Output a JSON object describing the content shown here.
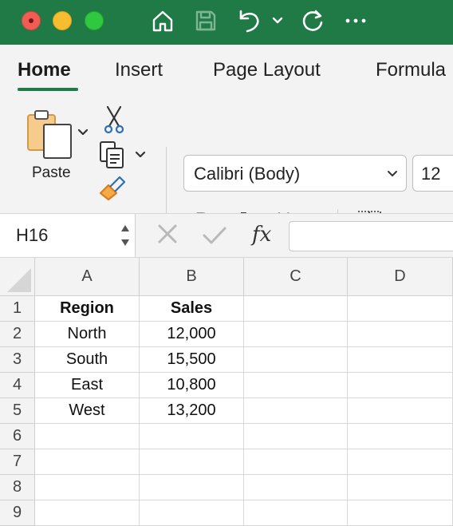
{
  "ribbon": {
    "tabs": [
      {
        "label": "Home",
        "active": true
      },
      {
        "label": "Insert"
      },
      {
        "label": "Page Layout"
      },
      {
        "label": "Formula"
      }
    ],
    "paste_label": "Paste",
    "font_name": "Calibri (Body)",
    "font_size": "12",
    "bold_label": "B",
    "italic_label": "I",
    "underline_label": "U"
  },
  "formula_bar": {
    "name_box": "H16",
    "fx_label": "fx",
    "formula": ""
  },
  "sheet": {
    "columns": [
      "A",
      "B",
      "C",
      "D"
    ],
    "rows": [
      "1",
      "2",
      "3",
      "4",
      "5",
      "6",
      "7",
      "8",
      "9"
    ],
    "cells": [
      [
        "Region",
        "Sales"
      ],
      [
        "North",
        "12,000"
      ],
      [
        "South",
        "15,500"
      ],
      [
        "East",
        "10,800"
      ],
      [
        "West",
        "13,200"
      ]
    ]
  },
  "colors": {
    "title_bar": "#1f7a46",
    "accent": "#1f7a46",
    "ribbon_bg": "#f3f3f3"
  }
}
